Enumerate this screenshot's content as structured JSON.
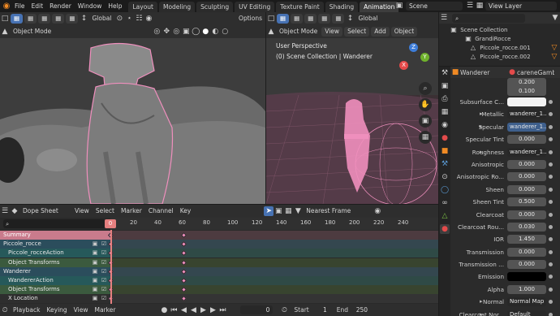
{
  "menus": [
    "File",
    "Edit",
    "Render",
    "Window",
    "Help"
  ],
  "workspace_tabs": [
    "Layout",
    "Modeling",
    "Sculpting",
    "UV Editing",
    "Texture Paint",
    "Shading",
    "Animation"
  ],
  "active_tab_index": 6,
  "scene": "Scene",
  "view_layer": "View Layer",
  "left_vp": {
    "transform": "Global",
    "options": "Options",
    "mode": "Object Mode",
    "menus": [
      "View",
      "Select",
      "Add",
      "Object"
    ]
  },
  "right_vp": {
    "transform": "Global",
    "mode": "Object Mode",
    "menus": [
      "View",
      "Select",
      "Add",
      "Object"
    ],
    "overlay_title": "User Perspective",
    "overlay_sub": "(0) Scene Collection | Wanderer",
    "gizmo": {
      "z": "Z",
      "y": "Y",
      "x": "X"
    }
  },
  "outliner": {
    "rows": [
      {
        "label": "Scene Collection",
        "indent": 0
      },
      {
        "label": "GrandiRocce",
        "indent": 1
      },
      {
        "label": "Piccole_rocce.001",
        "indent": 2
      },
      {
        "label": "Piccole_rocce.002",
        "indent": 2
      }
    ]
  },
  "properties": {
    "object": "Wanderer",
    "material": "careneGamb",
    "top_values": [
      "0.200",
      "0.100"
    ],
    "rows": [
      {
        "label": "Subsurface C...",
        "value": "",
        "kind": "white"
      },
      {
        "label": "Metallic",
        "value": "wanderer_1...",
        "kind": "link"
      },
      {
        "label": "Specular",
        "value": "wanderer_1...",
        "kind": "linkblue"
      },
      {
        "label": "Specular Tint",
        "value": "0.000",
        "kind": "num"
      },
      {
        "label": "Roughness",
        "value": "wanderer_1...",
        "kind": "link"
      },
      {
        "label": "Anisotropic",
        "value": "0.000",
        "kind": "num"
      },
      {
        "label": "Anisotropic Ro...",
        "value": "0.000",
        "kind": "num"
      },
      {
        "label": "Sheen",
        "value": "0.000",
        "kind": "num"
      },
      {
        "label": "Sheen Tint",
        "value": "0.500",
        "kind": "bar"
      },
      {
        "label": "Clearcoat",
        "value": "0.000",
        "kind": "num"
      },
      {
        "label": "Clearcoat Rou...",
        "value": "0.030",
        "kind": "num"
      },
      {
        "label": "IOR",
        "value": "1.450",
        "kind": "num"
      },
      {
        "label": "Transmission",
        "value": "0.000",
        "kind": "num"
      },
      {
        "label": "Transmission ...",
        "value": "0.000",
        "kind": "num"
      },
      {
        "label": "Emission",
        "value": "",
        "kind": "black"
      },
      {
        "label": "Alpha",
        "value": "1.000",
        "kind": "bar"
      },
      {
        "label": "Normal",
        "value": "Normal Map",
        "kind": "link"
      },
      {
        "label": "Clearcoat Nor...",
        "value": "Default",
        "kind": "link"
      }
    ]
  },
  "dopesheet": {
    "editor": "Dope Sheet",
    "menus": [
      "View",
      "Select",
      "Marker",
      "Channel",
      "Key"
    ],
    "interp": "Nearest Frame",
    "ticks": [
      "0",
      "20",
      "40",
      "60",
      "80",
      "100",
      "120",
      "140",
      "160",
      "180",
      "200",
      "220",
      "240"
    ],
    "current_frame": "0",
    "channels": [
      {
        "label": "Summary",
        "type": "summary",
        "key0": true,
        "key60": true
      },
      {
        "label": "Piccole_rocce",
        "type": "object",
        "key0": true,
        "key60": true
      },
      {
        "label": "Piccole_rocceAction",
        "type": "action",
        "key0": true,
        "key60": true
      },
      {
        "label": "Object Transforms",
        "type": "group",
        "key0": true,
        "key60": true
      },
      {
        "label": "Wanderer",
        "type": "object",
        "key0": true,
        "key60": true
      },
      {
        "label": "WandererAction",
        "type": "action",
        "key0": true,
        "key60": true
      },
      {
        "label": "Object Transforms",
        "type": "group",
        "key0": true,
        "key60": true
      },
      {
        "label": "X Location",
        "type": "fcurve",
        "key0": true,
        "key60": true
      }
    ]
  },
  "timeline": {
    "playback": "Playback",
    "keying": "Keying",
    "view": "View",
    "marker": "Marker",
    "frame": "0",
    "start_label": "Start",
    "start": "1",
    "end_label": "End",
    "end": "250"
  },
  "colors": {
    "accent": "#4772b3",
    "selection": "#ef8fbd",
    "playhead": "#e67f7f"
  }
}
